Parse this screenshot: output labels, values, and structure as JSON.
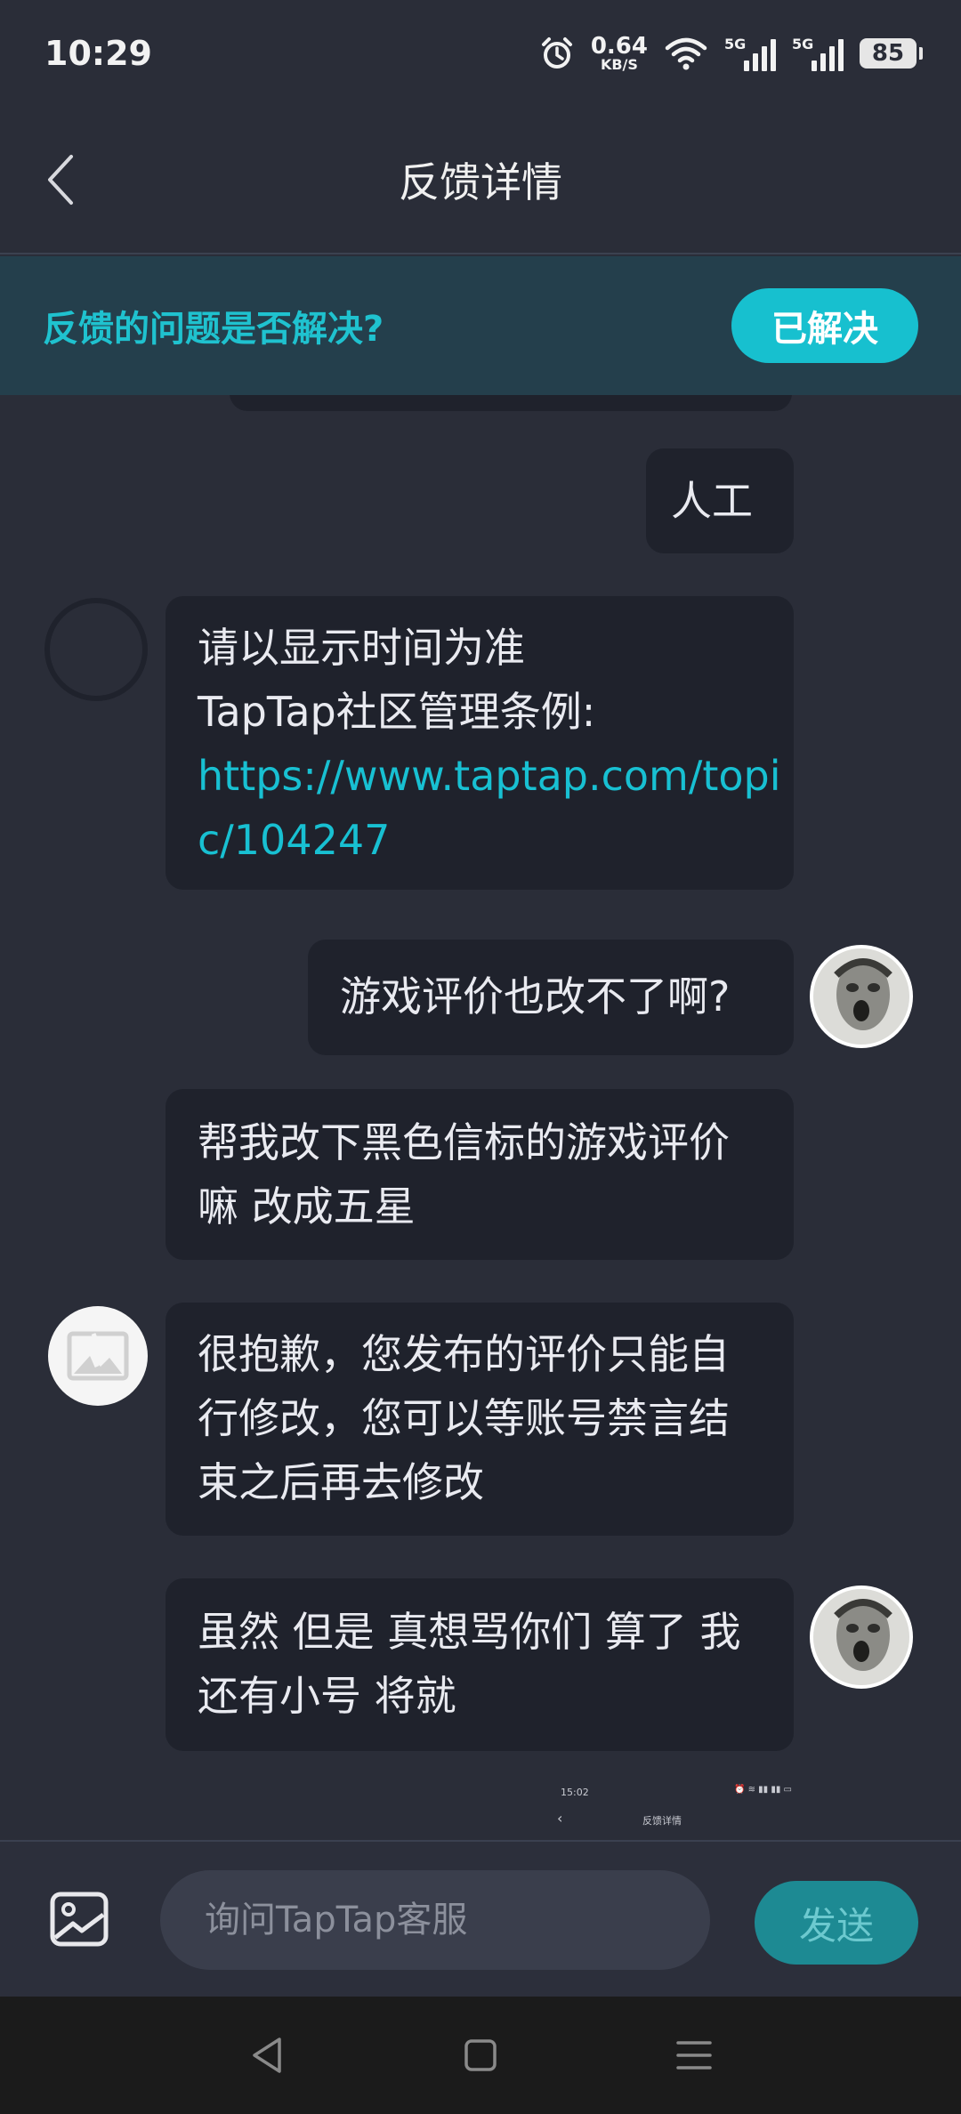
{
  "status_bar": {
    "time": "10:29",
    "net_speed_value": "0.64",
    "net_speed_unit": "KB/S",
    "signal1_label": "5G",
    "signal2_label": "5G",
    "battery": "85",
    "icons": [
      "alarm-icon",
      "wifi-icon",
      "signal-icon",
      "signal-icon",
      "battery-icon"
    ]
  },
  "header": {
    "title": "反馈详情",
    "back_icon": "chevron-left-icon"
  },
  "banner": {
    "question": "反馈的问题是否解决?",
    "button_label": "已解决"
  },
  "messages": [
    {
      "side": "right",
      "lines": [
        "人工"
      ]
    },
    {
      "side": "left",
      "avatar": "empty",
      "lines": [
        "请以显示时间为准",
        "TapTap社区管理条例:"
      ],
      "link_lines": [
        "https://www.taptap.com/topi",
        "c/104247"
      ]
    },
    {
      "side": "right",
      "avatar": "user",
      "lines": [
        "游戏评价也改不了啊?"
      ]
    },
    {
      "side": "left",
      "lines": [
        "帮我改下黑色信标的游戏评价",
        "嘛 改成五星"
      ]
    },
    {
      "side": "left",
      "avatar": "placeholder",
      "lines": [
        "很抱歉，您发布的评价只能自",
        "行修改，您可以等账号禁言结",
        "束之后再去修改"
      ]
    },
    {
      "side": "left",
      "avatar": "user",
      "lines": [
        "虽然 但是 真想骂你们 算了 我",
        "还有小号 将就"
      ]
    }
  ],
  "mini_screenshot": {
    "time": "15:02",
    "title": "反馈详情"
  },
  "input_bar": {
    "placeholder": "询问TapTap客服",
    "send_label": "发送",
    "image_icon": "image-icon"
  },
  "nav_bar": {
    "icons": [
      "back-triangle-icon",
      "home-square-icon",
      "menu-lines-icon"
    ]
  },
  "colors": {
    "background": "#2a2d38",
    "accent": "#17c0cf",
    "bubble": "#1f222c",
    "banner": "#243f4c"
  }
}
